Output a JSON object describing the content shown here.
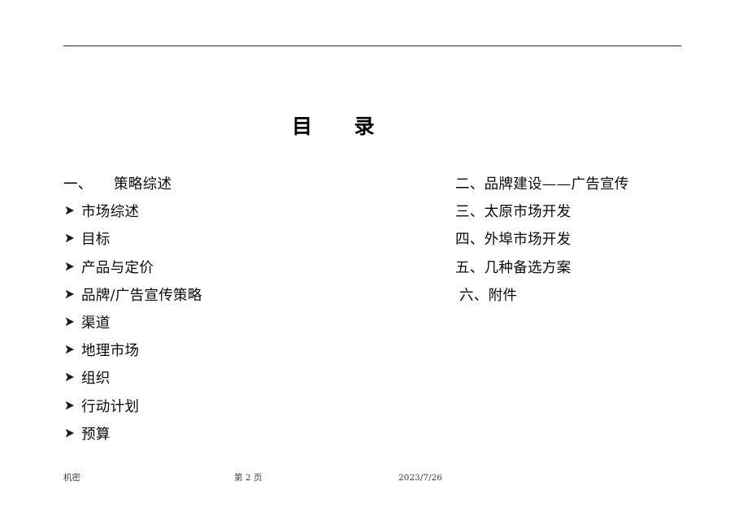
{
  "document": {
    "title": "目　　录",
    "header_rule": true
  },
  "toc": {
    "left_column": [
      {
        "numeral": "一、",
        "label": "策略综述",
        "bullet": false
      },
      {
        "label": "市场综述",
        "bullet": true,
        "bullet_icon": "arrowhead-bullet-icon"
      },
      {
        "label": "目标",
        "bullet": true,
        "bullet_icon": "arrowhead-bullet-icon"
      },
      {
        "label": "产品与定价",
        "bullet": true,
        "bullet_icon": "arrowhead-bullet-icon"
      },
      {
        "label": "品牌/广告宣传策略",
        "bullet": true,
        "bullet_icon": "arrowhead-bullet-icon"
      },
      {
        "label": "渠道",
        "bullet": true,
        "bullet_icon": "arrowhead-bullet-icon"
      },
      {
        "label": "地理市场",
        "bullet": true,
        "bullet_icon": "arrowhead-bullet-icon"
      },
      {
        "label": "组织",
        "bullet": true,
        "bullet_icon": "arrowhead-bullet-icon"
      },
      {
        "label": "行动计划",
        "bullet": true,
        "bullet_icon": "arrowhead-bullet-icon"
      },
      {
        "label": "预算",
        "bullet": true,
        "bullet_icon": "arrowhead-bullet-icon"
      }
    ],
    "right_column": [
      {
        "label": "二、品牌建设——广告宣传"
      },
      {
        "label": "三、太原市场开发"
      },
      {
        "label": "四、外埠市场开发"
      },
      {
        "label": "五、几种备选方案"
      },
      {
        "label": "六、附件",
        "indent": true
      }
    ]
  },
  "footer": {
    "left": "机密",
    "center": "第 2 页",
    "right": "2023/7/26"
  },
  "colors": {
    "text": "#0a0a0a",
    "rule": "#2b2b2b",
    "footer_text": "#3d3d3d",
    "background": "#ffffff"
  }
}
